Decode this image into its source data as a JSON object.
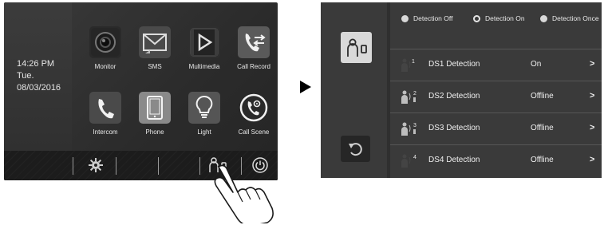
{
  "left_screen": {
    "clock": {
      "time": "14:26   PM",
      "day": "Tue.",
      "date": "08/03/2016"
    },
    "apps": [
      {
        "label": "Monitor",
        "icon": "camera-icon"
      },
      {
        "label": "SMS",
        "icon": "envelope-icon"
      },
      {
        "label": "Multimedia",
        "icon": "play-icon"
      },
      {
        "label": "Call Record",
        "icon": "call-record-icon"
      },
      {
        "label": "Intercom",
        "icon": "phone-handset-icon"
      },
      {
        "label": "Phone",
        "icon": "tablet-icon"
      },
      {
        "label": "Light",
        "icon": "lightbulb-icon"
      },
      {
        "label": "Call Scene",
        "icon": "call-scene-icon"
      }
    ],
    "bottom_bar": [
      "settings-gear-icon",
      "detection-sensor-icon",
      "power-icon"
    ]
  },
  "right_screen": {
    "detection_modes": [
      {
        "label": "Detection Off",
        "selected": false
      },
      {
        "label": "Detection On",
        "selected": true
      },
      {
        "label": "Detection Once",
        "selected": false
      }
    ],
    "sensors": [
      {
        "index": "1",
        "name": "DS1 Detection",
        "status": "On",
        "arrow": ">"
      },
      {
        "index": "2",
        "name": "DS2 Detection",
        "status": "Offline",
        "arrow": ">"
      },
      {
        "index": "3",
        "name": "DS3 Detection",
        "status": "Offline",
        "arrow": ">"
      },
      {
        "index": "4",
        "name": "DS4 Detection",
        "status": "Offline",
        "arrow": ">"
      }
    ]
  },
  "colors": {
    "screen_bg": "#3a3a3a",
    "bar_bg": "#1c1c1c",
    "text": "#e8e8e8"
  }
}
